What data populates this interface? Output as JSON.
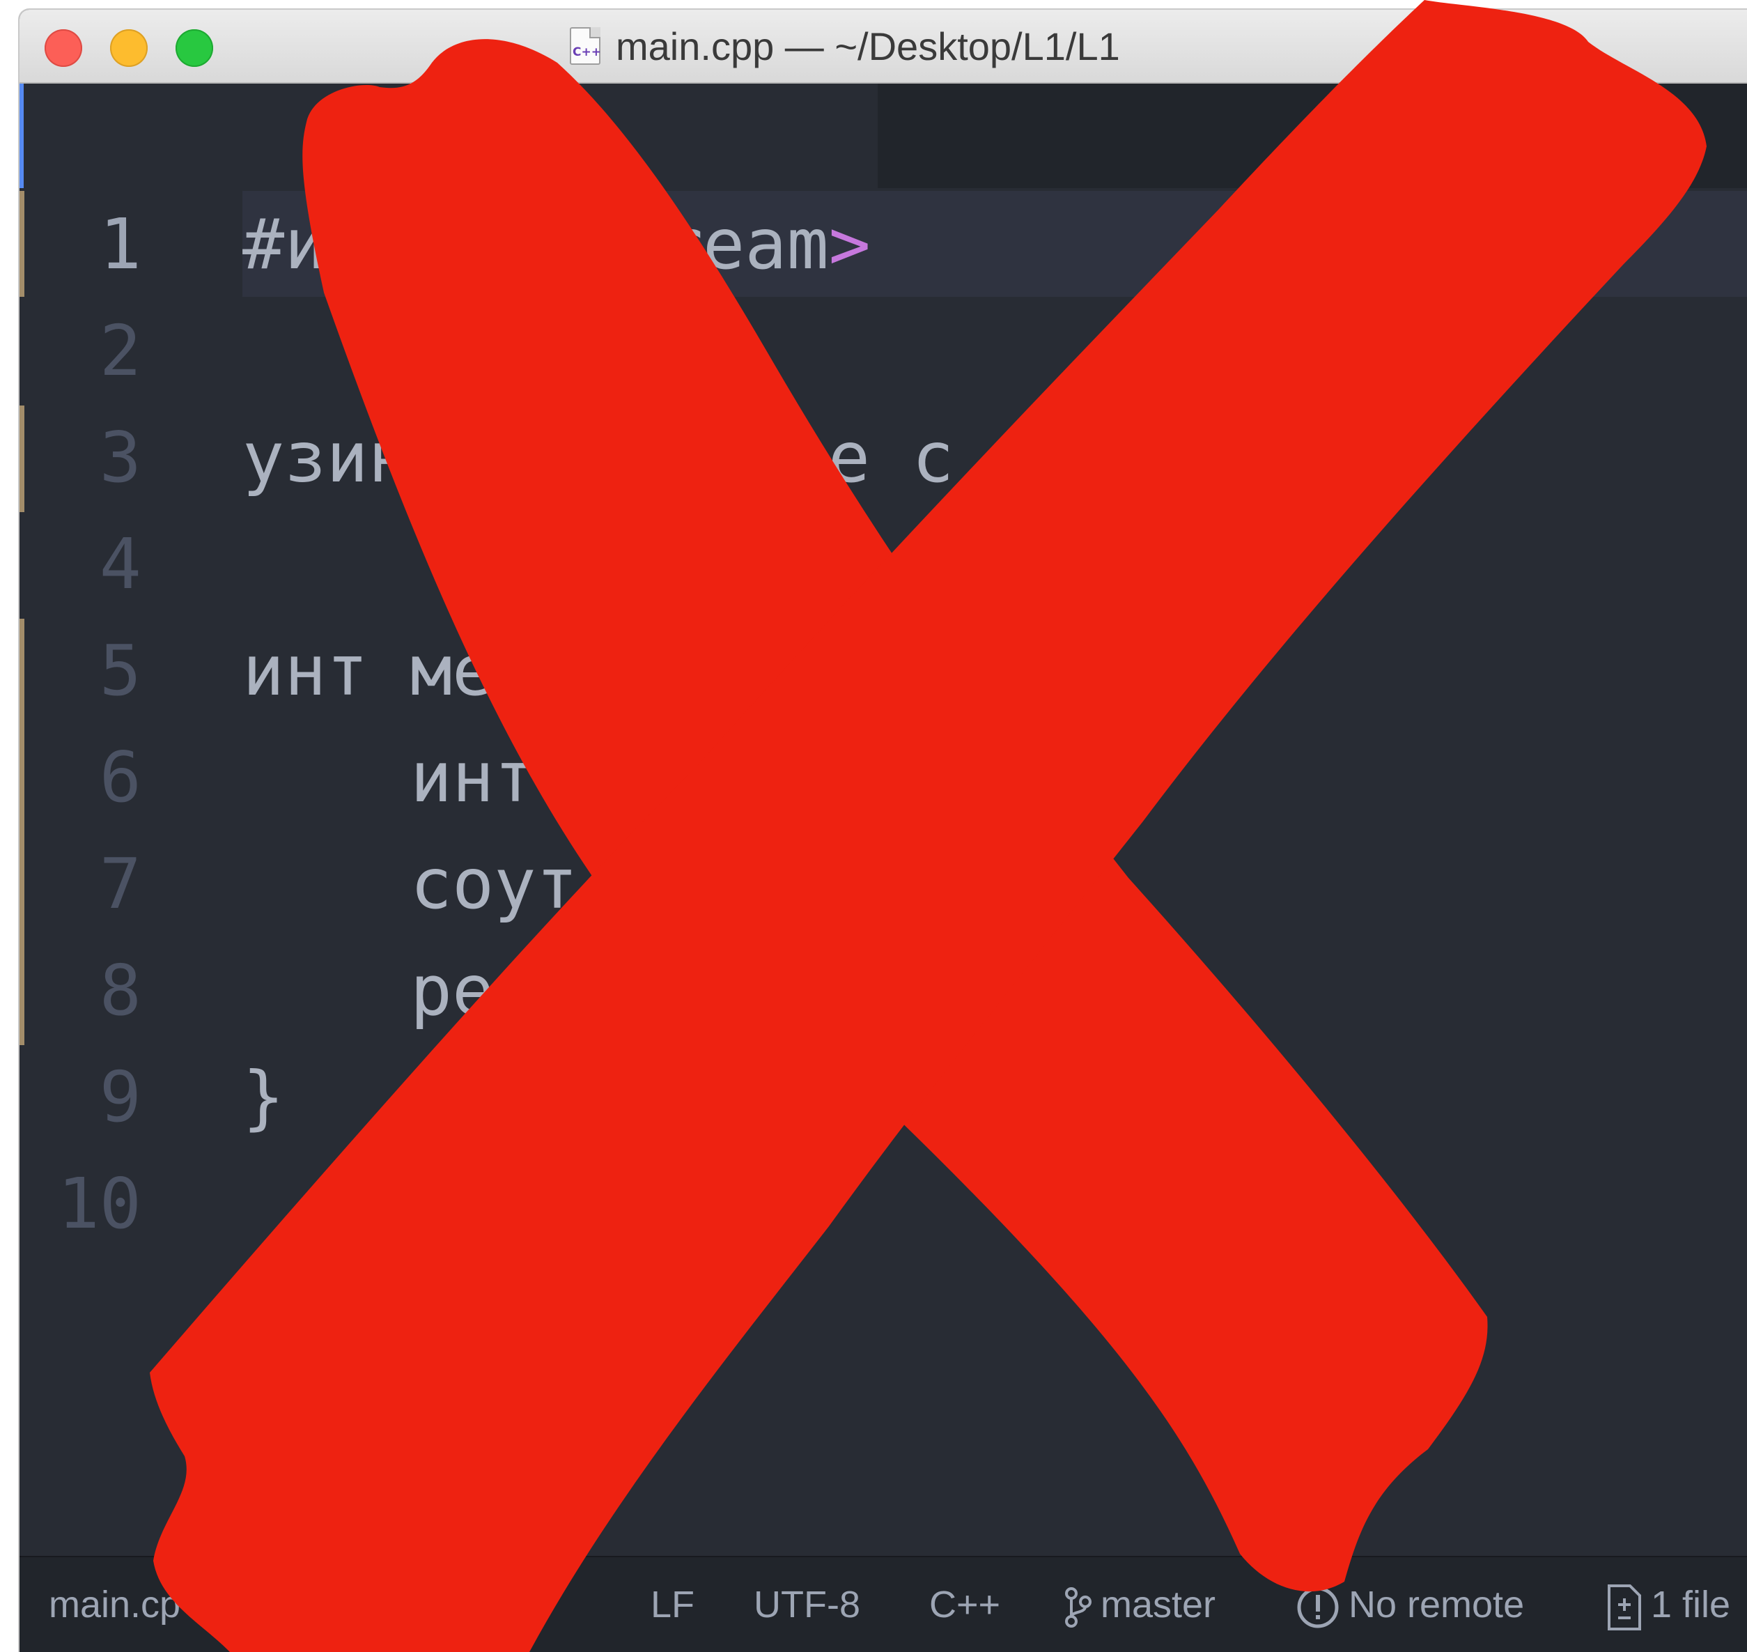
{
  "window": {
    "title": "main.cpp — ~/Desktop/L1/L1",
    "file_icon_label": "C++"
  },
  "editor": {
    "lines": [
      {
        "number": "1",
        "text": "#и",
        "suffix": "stream",
        "punct": ">"
      },
      {
        "number": "2",
        "text": ""
      },
      {
        "number": "3",
        "text": "узин",
        "suffix": "e c"
      },
      {
        "number": "4",
        "text": ""
      },
      {
        "number": "5",
        "text": "инт ме"
      },
      {
        "number": "6",
        "text": "    инт"
      },
      {
        "number": "7",
        "text": "    соут",
        "suffix": ";"
      },
      {
        "number": "8",
        "text": "    ре"
      },
      {
        "number": "9",
        "text": "}"
      },
      {
        "number": "10",
        "text": ""
      }
    ]
  },
  "statusbar": {
    "file": "main.cp",
    "line_ending": "LF",
    "encoding": "UTF-8",
    "grammar": "C++",
    "branch": "master",
    "remote": "No remote",
    "changes": "1 file"
  },
  "colors": {
    "editor_bg": "#282c34",
    "overlay_red": "#ee2211",
    "accent": "#568af2"
  }
}
